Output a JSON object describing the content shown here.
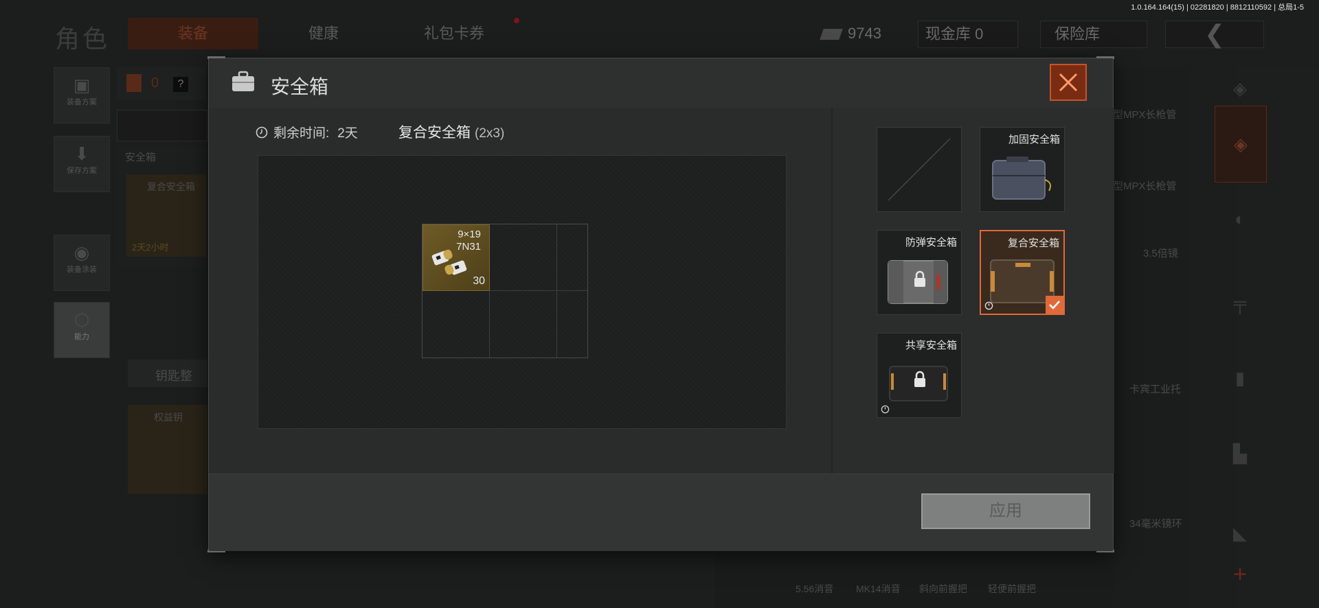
{
  "version_text": "1.0.164.164(15) | 02281820 | 8812110592 | 总局1-5",
  "background": {
    "title": "角色",
    "tabs": [
      "装备",
      "健康",
      "礼包卡券"
    ],
    "currency_value": "9743",
    "cash_vault_label": "现金库 0",
    "insurance_label": "保险库",
    "left_buttons": [
      "装备方案",
      "保存方案",
      "装备涂装",
      "能力"
    ],
    "armor_count": "0",
    "help_label": "?",
    "section_label": "安全箱",
    "bg_case_label": "复合安全箱",
    "bg_case_timer": "2天2小时",
    "key_label": "钥匙整",
    "rights_label": "权益钥",
    "right_items": [
      "型MPX长枪管",
      "型MPX长枪管",
      "3.5倍镜",
      "卡宾工业托",
      "34毫米镜环"
    ],
    "bottom_items": [
      "5.56消音",
      "MK14消音",
      "斜向前握把",
      "轻便前握把"
    ]
  },
  "modal": {
    "title": "安全箱",
    "remaining_label": "剩余时间:",
    "remaining_value": "2天",
    "case_name": "复合安全箱",
    "case_size": "(2x3)",
    "item": {
      "name_line1": "9×19",
      "name_line2": "7N31",
      "count": "30"
    },
    "cases": [
      {
        "label": "",
        "state": "empty"
      },
      {
        "label": "加固安全箱",
        "state": "available"
      },
      {
        "label": "防弹安全箱",
        "state": "locked"
      },
      {
        "label": "复合安全箱",
        "state": "selected"
      },
      {
        "label": "共享安全箱",
        "state": "locked"
      }
    ],
    "apply_label": "应用"
  },
  "colors": {
    "accent": "#e0693a",
    "close_bg": "#7a2c12",
    "item_gold": "#6e5a26",
    "apply_disabled": "#7e7f7f"
  },
  "icons": [
    "briefcase-icon",
    "close-icon",
    "clock-icon",
    "ammo-icon",
    "checkmark-icon",
    "lock-icon"
  ]
}
